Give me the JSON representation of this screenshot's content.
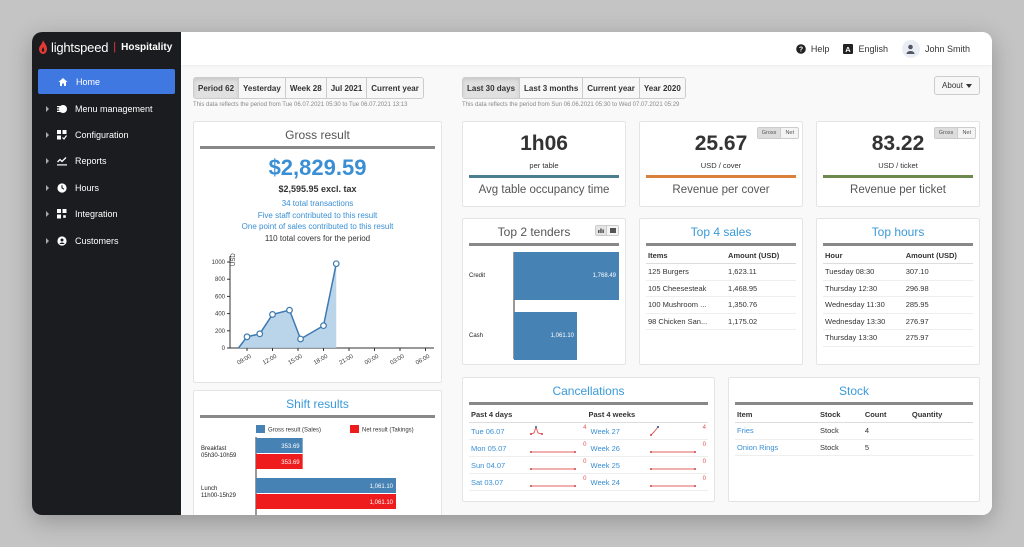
{
  "brand": {
    "name": "lightspeed",
    "product": "Hospitality",
    "accent": "#e53935"
  },
  "sidebar": {
    "items": [
      {
        "label": "Home",
        "icon": "home-icon",
        "active": true
      },
      {
        "label": "Menu management",
        "icon": "menu-management-icon",
        "active": false
      },
      {
        "label": "Configuration",
        "icon": "configuration-icon",
        "active": false
      },
      {
        "label": "Reports",
        "icon": "reports-icon",
        "active": false
      },
      {
        "label": "Hours",
        "icon": "clock-icon",
        "active": false
      },
      {
        "label": "Integration",
        "icon": "integration-icon",
        "active": false
      },
      {
        "label": "Customers",
        "icon": "customers-icon",
        "active": false
      }
    ]
  },
  "topbar": {
    "help": "Help",
    "language": "English",
    "user": "John Smith"
  },
  "period_left": {
    "buttons": [
      "Period 62",
      "Yesterday",
      "Week 28",
      "Jul 2021",
      "Current year"
    ],
    "active": 0,
    "note": "This data reflects the period from Tue 06.07.2021 05:30 to Tue 06.07.2021 13:13"
  },
  "period_right": {
    "buttons": [
      "Last 30 days",
      "Last 3 months",
      "Current year",
      "Year 2020"
    ],
    "active": 0,
    "note": "This data reflects the period from Sun 06.06.2021 05:30 to Wed 07.07.2021 05:29"
  },
  "about_button": "About",
  "gross": {
    "title": "Gross result",
    "total": "$2,829.59",
    "excl_tax": "$2,595.95 excl. tax",
    "transactions": "34 total transactions",
    "staff": "Five staff contributed to this result",
    "pos": "One point of sales contributed to this result",
    "covers": "110 total covers for the period",
    "chart_data": {
      "type": "area",
      "ylabel": "USD",
      "ylim": [
        0,
        1000
      ],
      "yticks": [
        0,
        200,
        400,
        600,
        800,
        1000
      ],
      "xticks": [
        "09:00",
        "12:00",
        "15:00",
        "18:00",
        "21:00",
        "00:00",
        "03:00",
        "06:00"
      ],
      "x_hours": [
        8,
        9,
        10.5,
        12,
        14,
        15.3,
        18,
        19.5
      ],
      "values": [
        0,
        130,
        165,
        390,
        440,
        105,
        260,
        980
      ]
    }
  },
  "kpis": [
    {
      "value": "1h06",
      "unit": "per table",
      "label": "Avg table occupancy time",
      "color": "#4a7f8e",
      "toggle": null
    },
    {
      "value": "25.67",
      "unit": "USD / cover",
      "label": "Revenue per cover",
      "color": "#d9813b",
      "toggle": [
        "Gross",
        "Net"
      ]
    },
    {
      "value": "83.22",
      "unit": "USD / ticket",
      "label": "Revenue per ticket",
      "color": "#6b8a4c",
      "toggle": [
        "Gross",
        "Net"
      ]
    }
  ],
  "tenders": {
    "title": "Top 2 tenders",
    "chart_data": {
      "type": "bar",
      "categories": [
        "Credit",
        "Cash"
      ],
      "values": [
        1768.49,
        1061.1
      ],
      "labels": [
        "1,768.49",
        "1,061.10"
      ]
    }
  },
  "top_sales": {
    "title": "Top 4 sales",
    "headers": [
      "Items",
      "Amount (USD)"
    ],
    "rows": [
      [
        "125 Burgers",
        "1,623.11"
      ],
      [
        "105 Cheesesteak",
        "1,468.95"
      ],
      [
        "100 Mushroom ...",
        "1,350.76"
      ],
      [
        "98 Chicken San...",
        "1,175.02"
      ]
    ]
  },
  "top_hours": {
    "title": "Top hours",
    "headers": [
      "Hour",
      "Amount (USD)"
    ],
    "rows": [
      [
        "Tuesday 08:30",
        "307.10"
      ],
      [
        "Thursday 12:30",
        "296.98"
      ],
      [
        "Wednesday 11:30",
        "285.95"
      ],
      [
        "Wednesday 13:30",
        "276.97"
      ],
      [
        "Thursday 13:30",
        "275.97"
      ]
    ]
  },
  "shift": {
    "title": "Shift results",
    "legend": [
      "Gross result (Sales)",
      "Net result (Takings)"
    ],
    "colors": [
      "#4682b4",
      "#ee1c1c"
    ],
    "chart_data": {
      "type": "bar",
      "categories": [
        "Breakfast|05h30-10h59",
        "Lunch|11h00-15h29"
      ],
      "series": [
        {
          "name": "Gross result (Sales)",
          "values": [
            353.69,
            1061.1
          ],
          "labels": [
            "353.69",
            "1,061.10"
          ]
        },
        {
          "name": "Net result (Takings)",
          "values": [
            353.69,
            1061.1
          ],
          "labels": [
            "353.69",
            "1,061.10"
          ]
        }
      ]
    }
  },
  "cancellations": {
    "title": "Cancellations",
    "days_header": "Past 4 days",
    "weeks_header": "Past 4 weeks",
    "days": [
      {
        "label": "Tue 06.07",
        "count": "4",
        "shape": "peak"
      },
      {
        "label": "Mon 05.07",
        "count": "0",
        "shape": "flat"
      },
      {
        "label": "Sun 04.07",
        "count": "0",
        "shape": "flat"
      },
      {
        "label": "Sat 03.07",
        "count": "0",
        "shape": "flat"
      }
    ],
    "weeks": [
      {
        "label": "Week 27",
        "count": "4",
        "shape": "rise"
      },
      {
        "label": "Week 26",
        "count": "0",
        "shape": "flat"
      },
      {
        "label": "Week 25",
        "count": "0",
        "shape": "flat"
      },
      {
        "label": "Week 24",
        "count": "0",
        "shape": "flat"
      }
    ]
  },
  "stock": {
    "title": "Stock",
    "headers": [
      "Item",
      "Stock",
      "Count",
      "Quantity"
    ],
    "rows": [
      [
        "Fries",
        "Stock",
        "4",
        ""
      ],
      [
        "Onion Rings",
        "Stock",
        "5",
        ""
      ]
    ]
  }
}
